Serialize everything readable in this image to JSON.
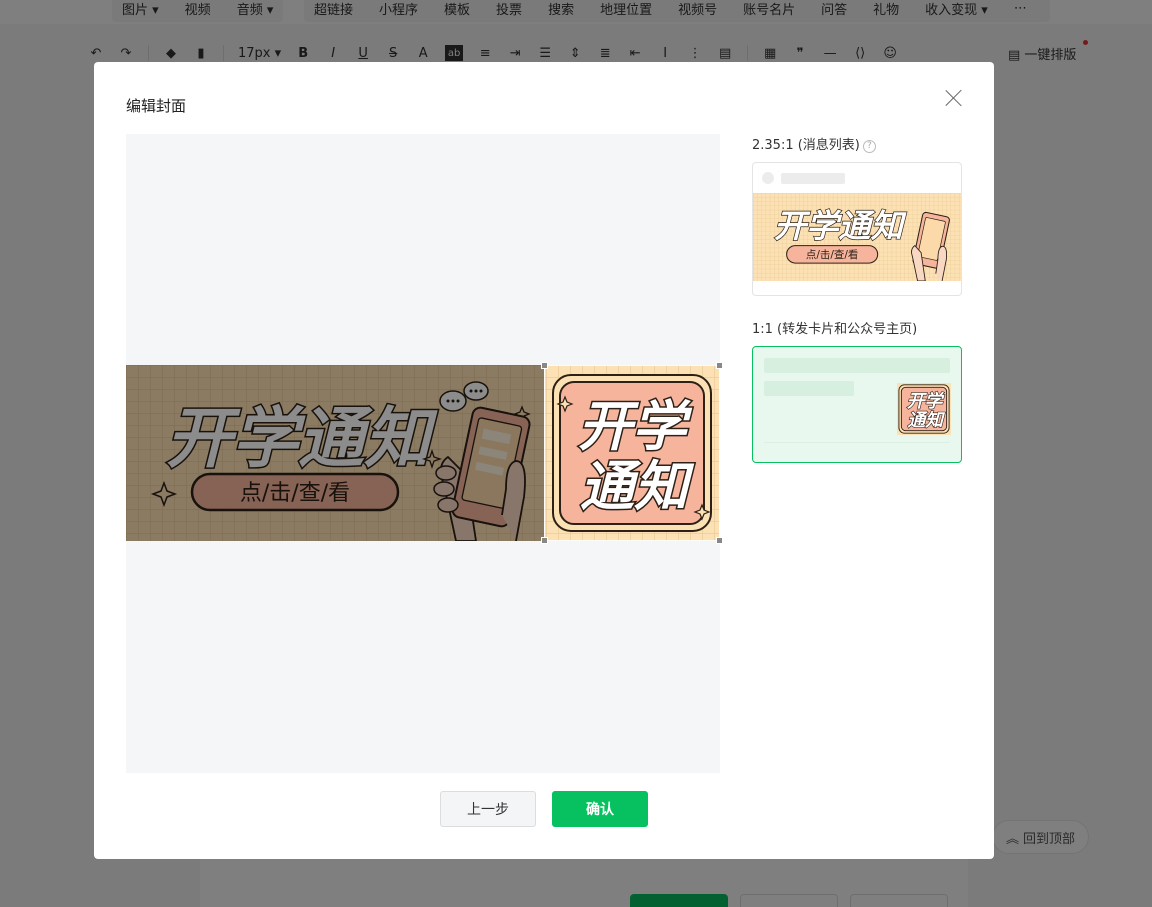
{
  "editor_bg": {
    "menu_left": [
      "图片 ▾",
      "视频",
      "音频 ▾"
    ],
    "menu_right": [
      "超链接",
      "小程序",
      "模板",
      "投票",
      "搜索",
      "地理位置",
      "视频号",
      "账号名片",
      "问答",
      "礼物",
      "收入变现 ▾",
      "⋯"
    ],
    "font_size": "17px ▾",
    "onekey_layout": "一键排版",
    "back_to_top": "回到顶部"
  },
  "modal": {
    "title": "编辑封面",
    "preview_ratio_1": "2.35:1 (消息列表)",
    "preview_ratio_2": "1:1 (转发卡片和公众号主页)",
    "prev_button": "上一步",
    "confirm_button": "确认"
  },
  "cover": {
    "headline": "开学通知",
    "headline_square_top": "开学",
    "headline_square_bottom": "通知",
    "subtitle": "点/击/查/看",
    "colors": {
      "bg": "#fbe1b3",
      "grid": "#e6c48e",
      "pill": "#f6b49c",
      "outline": "#2c2017",
      "accent_green": "#07c160"
    }
  }
}
